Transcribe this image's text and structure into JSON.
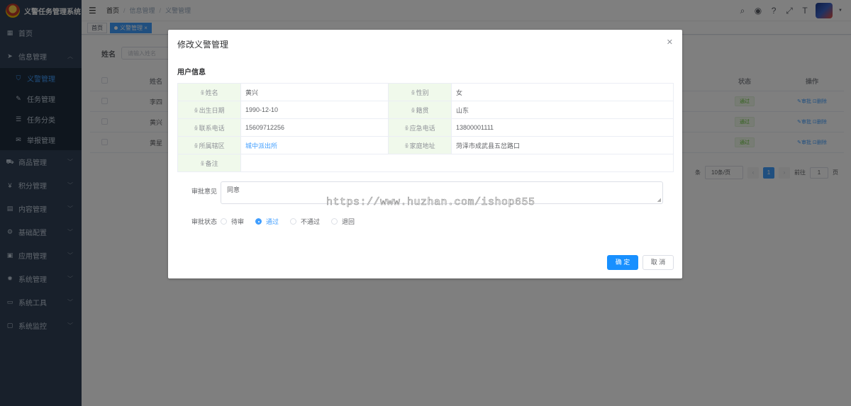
{
  "app": {
    "title": "义警任务管理系统"
  },
  "sidebar": {
    "items": [
      {
        "label": "首页",
        "icon": "dashboard-icon"
      },
      {
        "label": "信息管理",
        "icon": "send-icon",
        "expanded": true
      },
      {
        "label": "义警管理",
        "icon": "user-shield-icon",
        "active": true,
        "sub": true
      },
      {
        "label": "任务管理",
        "icon": "task-icon",
        "sub": true
      },
      {
        "label": "任务分类",
        "icon": "category-icon",
        "sub": true
      },
      {
        "label": "举报管理",
        "icon": "report-icon",
        "sub": true
      },
      {
        "label": "商品管理",
        "icon": "cart-icon"
      },
      {
        "label": "积分管理",
        "icon": "yen-icon"
      },
      {
        "label": "内容管理",
        "icon": "content-icon"
      },
      {
        "label": "基础配置",
        "icon": "config-icon"
      },
      {
        "label": "应用管理",
        "icon": "app-icon"
      },
      {
        "label": "系统管理",
        "icon": "gear-icon"
      },
      {
        "label": "系统工具",
        "icon": "tool-icon"
      },
      {
        "label": "系统监控",
        "icon": "monitor-icon"
      }
    ]
  },
  "navbar": {
    "breadcrumb": [
      "首页",
      "信息管理",
      "义警管理"
    ],
    "tools": [
      "search-icon",
      "github-icon",
      "question-icon",
      "fullscreen-icon",
      "font-size-icon"
    ]
  },
  "tags": [
    "首页",
    "义警管理"
  ],
  "search": {
    "label": "姓名",
    "placeholder": "请输入姓名"
  },
  "table": {
    "headers": {
      "name": "姓名",
      "status": "状态",
      "ops": "操作"
    },
    "rows": [
      {
        "name": "李四",
        "status": "通过"
      },
      {
        "name": "黄兴",
        "status": "通过"
      },
      {
        "name": "黄星",
        "status": "通过"
      }
    ],
    "op_edit": "✎审批",
    "op_delete": "⊡删除"
  },
  "pagination": {
    "total_suffix": "条",
    "page_size": "10条/页",
    "current": "1",
    "goto_label": "前往",
    "goto_value": "1",
    "page_suffix": "页"
  },
  "dialog": {
    "title": "修改义警管理",
    "section": "用户信息",
    "fields": {
      "name_label": "姓名",
      "name": "黄兴",
      "gender_label": "性别",
      "gender": "女",
      "birth_label": "出生日期",
      "birth": "1990-12-10",
      "native_label": "籍贯",
      "native": "山东",
      "phone_label": "联系电话",
      "phone": "15609712256",
      "emergency_label": "应急电话",
      "emergency": "13800001111",
      "district_label": "所属辖区",
      "district": "城中派出所",
      "address_label": "家庭地址",
      "address": "菏泽市成武县五岔路口",
      "remark_label": "备注",
      "remark": ""
    },
    "opinion_label": "审批意见",
    "opinion_value": "同意",
    "status_label": "审批状态",
    "status_options": [
      "待审",
      "通过",
      "不通过",
      "退回"
    ],
    "status_selected": "通过",
    "confirm": "确 定",
    "cancel": "取 消"
  },
  "watermark": "https://www.huzhan.com/ishop655",
  "colors": {
    "sidebar_bg": "#304156",
    "primary": "#1890ff",
    "label_bg": "#f0f9eb",
    "success": "#67c23a"
  }
}
